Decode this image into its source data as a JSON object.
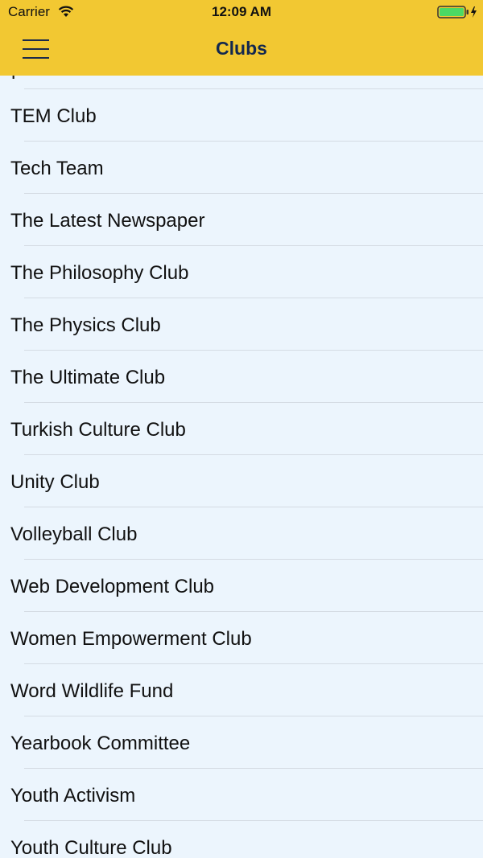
{
  "status_bar": {
    "carrier": "Carrier",
    "time": "12:09 AM",
    "wifi_icon": "wifi-icon",
    "battery_icon": "battery-charging-icon",
    "battery_color": "#4cd964"
  },
  "nav": {
    "title": "Clubs",
    "menu_icon": "hamburger-menu-icon",
    "bar_color": "#f2c832",
    "title_color": "#13284f"
  },
  "list": {
    "partial_top_item": "p",
    "items": [
      "TEM Club",
      "Tech Team",
      "The Latest Newspaper",
      "The Philosophy Club",
      "The Physics Club",
      "The Ultimate Club",
      "Turkish Culture Club",
      "Unity Club",
      "Volleyball Club",
      "Web Development Club",
      "Women Empowerment Club",
      "Word Wildlife Fund",
      "Yearbook Committee",
      "Youth Activism",
      "Youth Culture Club"
    ]
  }
}
